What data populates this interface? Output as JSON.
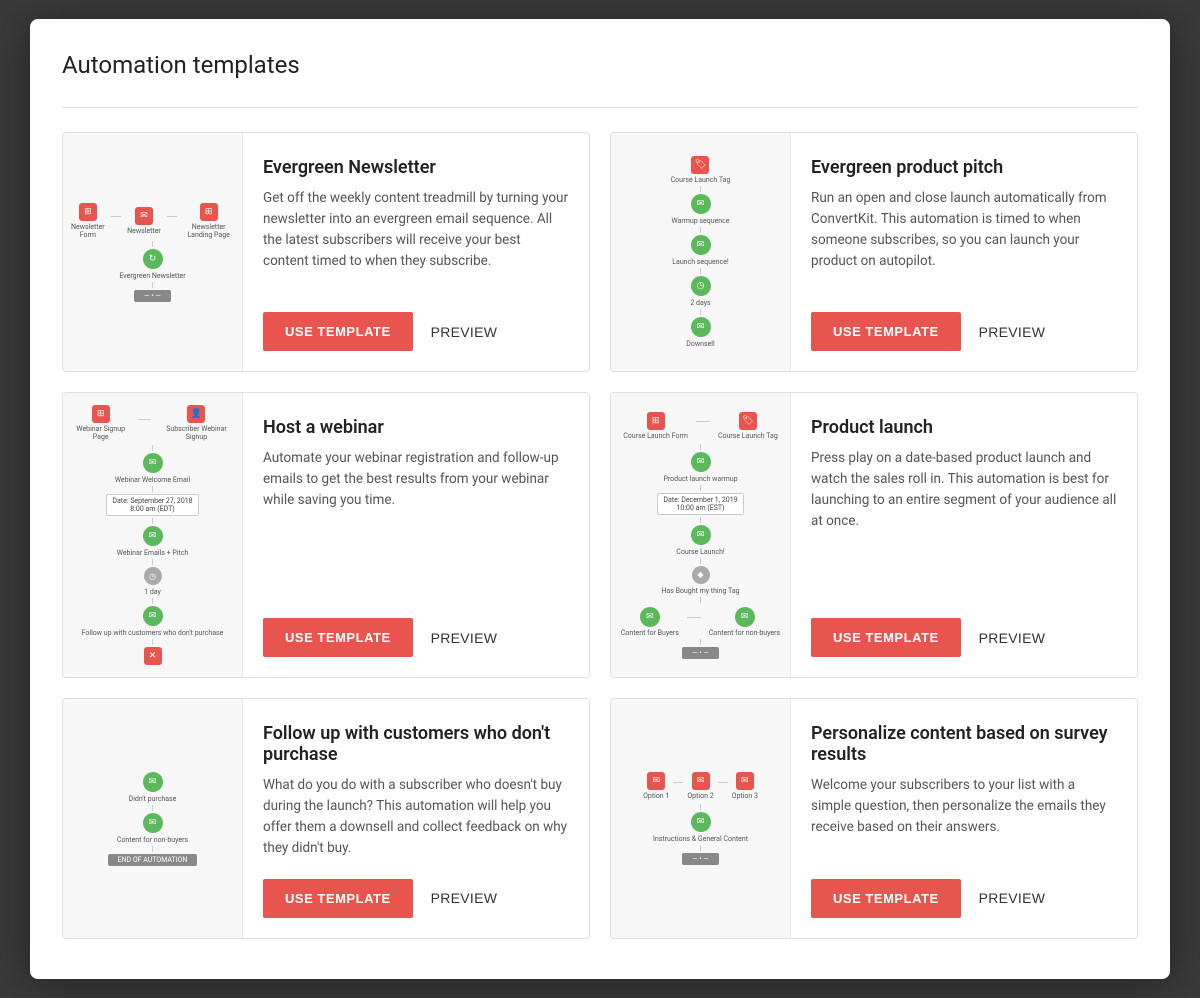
{
  "modal": {
    "title": "Automation templates"
  },
  "templates": [
    {
      "id": "evergreen-newsletter",
      "title": "Evergreen Newsletter",
      "description": "Get off the weekly content treadmill by turning your newsletter into an evergreen email sequence. All the latest subscribers will receive your best content timed to when they subscribe.",
      "use_template_label": "USE TEMPLATE",
      "preview_label": "PREVIEW",
      "diagram_type": "newsletter"
    },
    {
      "id": "evergreen-product-pitch",
      "title": "Evergreen product pitch",
      "description": "Run an open and close launch automatically from ConvertKit. This automation is timed to when someone subscribes, so you can launch your product on autopilot.",
      "use_template_label": "USE TEMPLATE",
      "preview_label": "PREVIEW",
      "diagram_type": "product-pitch"
    },
    {
      "id": "host-a-webinar",
      "title": "Host a webinar",
      "description": "Automate your webinar registration and follow-up emails to get the best results from your webinar while saving you time.",
      "use_template_label": "USE TEMPLATE",
      "preview_label": "PREVIEW",
      "diagram_type": "webinar"
    },
    {
      "id": "product-launch",
      "title": "Product launch",
      "description": "Press play on a date-based product launch and watch the sales roll in. This automation is best for launching to an entire segment of your audience all at once.",
      "use_template_label": "USE TEMPLATE",
      "preview_label": "PREVIEW",
      "diagram_type": "product-launch"
    },
    {
      "id": "follow-up-customers",
      "title": "Follow up with customers who don't purchase",
      "description": "What do you do with a subscriber who doesn't buy during the launch? This automation will help you offer them a downsell and collect feedback on why they didn't buy.",
      "use_template_label": "USE TEMPLATE",
      "preview_label": "PREVIEW",
      "diagram_type": "follow-up"
    },
    {
      "id": "personalize-survey",
      "title": "Personalize content based on survey results",
      "description": "Welcome your subscribers to your list with a simple question, then personalize the emails they receive based on their answers.",
      "use_template_label": "USE TEMPLATE",
      "preview_label": "PREVIEW",
      "diagram_type": "survey"
    }
  ]
}
